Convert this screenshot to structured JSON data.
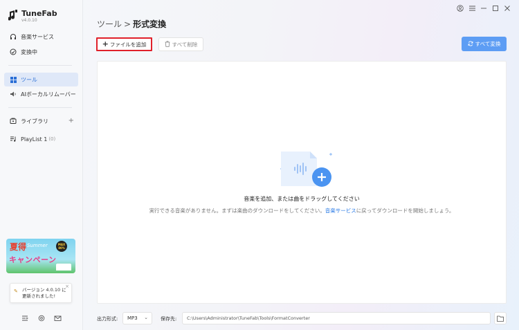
{
  "app": {
    "name": "TuneFab",
    "version": "v4.0.10"
  },
  "sidebar": {
    "items": [
      {
        "label": "音楽サービス",
        "icon": "headphones-icon"
      },
      {
        "label": "変換中",
        "icon": "convert-icon"
      },
      {
        "label": "ツール",
        "icon": "grid-icon",
        "active": true
      },
      {
        "label": "AIボーカルリムーバー",
        "icon": "vocal-remover-icon"
      },
      {
        "label": "ライブラリ",
        "icon": "library-icon"
      },
      {
        "label": "PlayList 1",
        "icon": "playlist-icon",
        "count": "(0)"
      }
    ]
  },
  "promo": {
    "title": "夏得",
    "sub": "Summer",
    "campaign": "キャンペーン",
    "badge": "MAX 80%"
  },
  "toast": {
    "text": "バージョン 4.0.10 に更新されました!"
  },
  "header": {
    "crumb": "ツール",
    "separator": ">",
    "current": "形式変換"
  },
  "toolbar": {
    "add_label": "ファイルを追加",
    "clear_label": "すべて削除",
    "convert_label": "すべて変換"
  },
  "empty": {
    "main": "音楽を追加、または曲をドラッグしてください",
    "sub_before": "実行できる音楽がありません。まずは楽曲のダウンロードをしてください。",
    "sub_link": "音楽サービス",
    "sub_after": "に戻ってダウンロードを開始しましょう。"
  },
  "footer": {
    "format_label": "出力形式:",
    "format_value": "MP3",
    "save_label": "保存先:",
    "save_path": "C:\\Users\\Administrator\\TuneFab\\Tools\\FormatConverter"
  },
  "colors": {
    "accent": "#5d9df4",
    "highlight": "#e0202a",
    "active_bg": "#dfe8f8",
    "link": "#2b7be6"
  }
}
